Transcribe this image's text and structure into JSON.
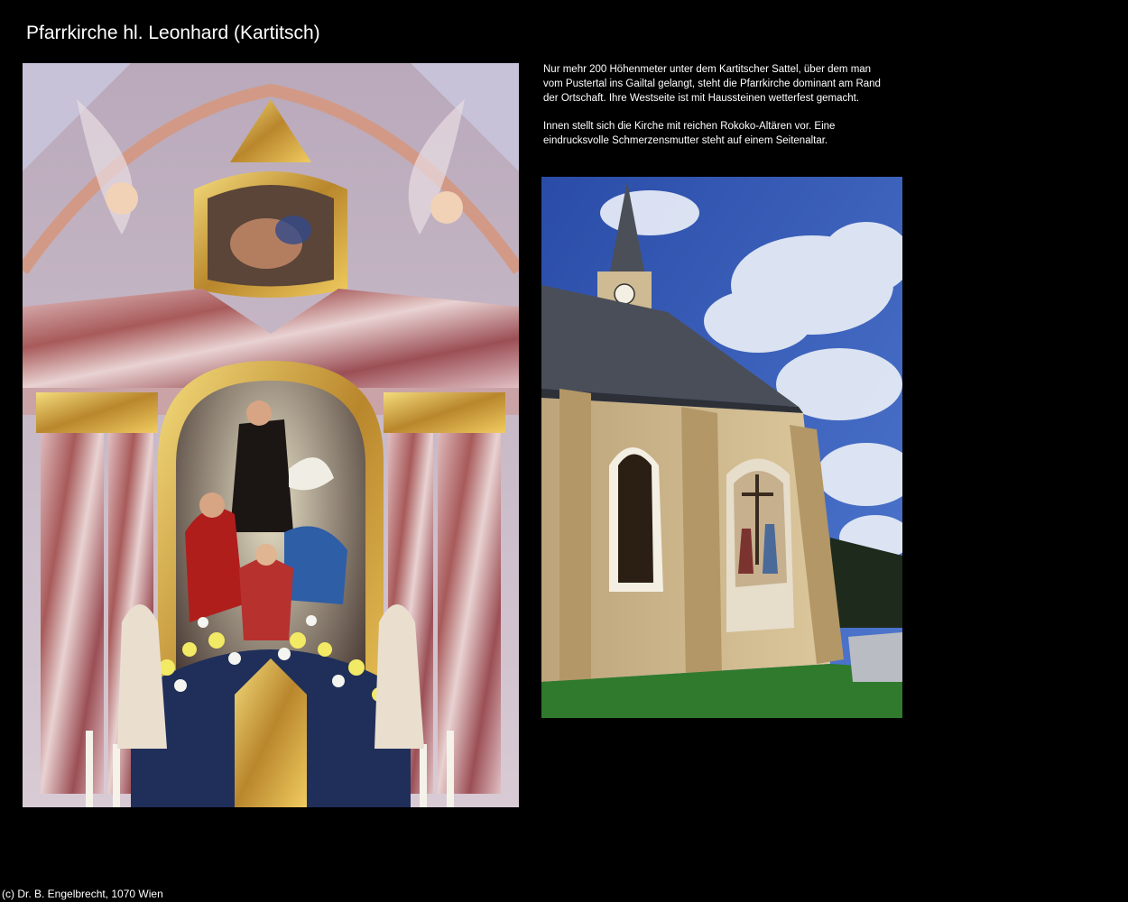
{
  "page": {
    "title": "Pfarrkirche hl. Leonhard (Kartitsch)",
    "description": [
      "Nur mehr 200 Höhenmeter unter dem Kartitscher Sattel, über dem man vom Pustertal ins Gailtal gelangt, steht die Pfarrkirche dominant am Rand der Ortschaft. Ihre Westseite ist mit Haussteinen wetterfest gemacht.",
      "Innen stellt sich die Kirche mit reichen Rokoko-Altären vor. Eine eindrucksvolle Schmerzensmutter steht auf einem Seitenaltar."
    ],
    "copyright": "(c) Dr. B. Engelbrecht, 1070 Wien"
  },
  "photos": {
    "altar": "rococo-high-altar-photo",
    "church": "church-exterior-photo"
  },
  "colors": {
    "background": "#000000",
    "text": "#ffffff",
    "sky": "#3c61bd",
    "facade": "#cdb58a",
    "roof": "#4a4e58",
    "marble_pink": "#c9a0a6",
    "gold": "#d7b04a"
  }
}
